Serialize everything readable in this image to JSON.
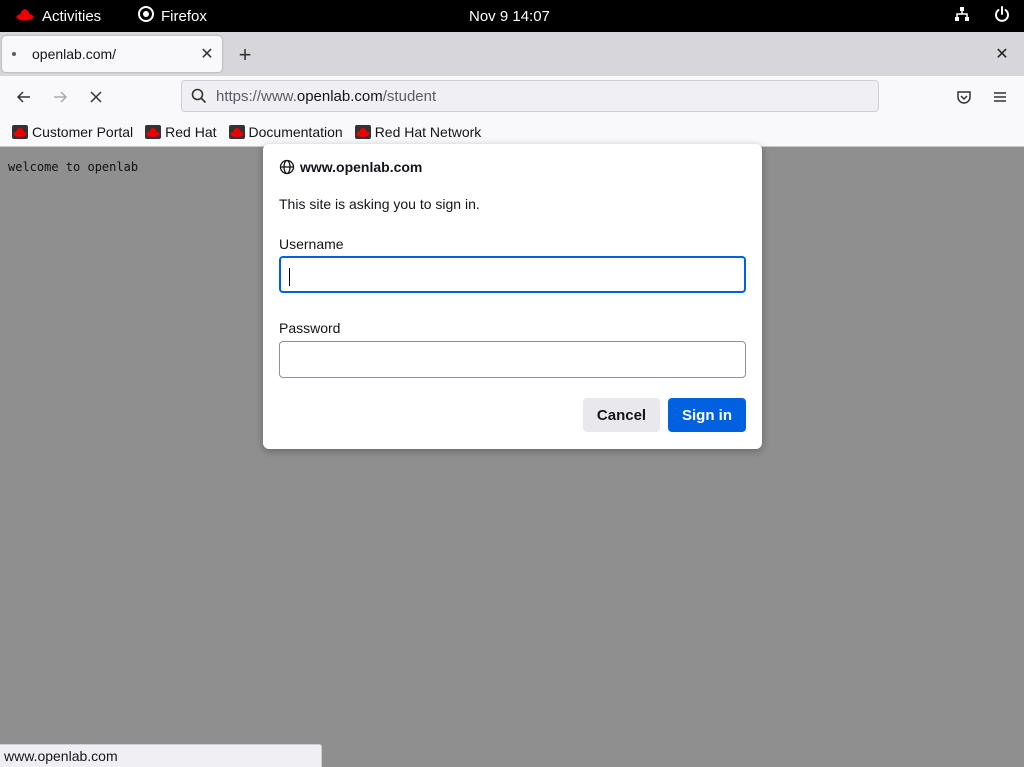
{
  "topbar": {
    "activities_label": "Activities",
    "app_label": "Firefox",
    "clock": "Nov 9  14:07",
    "icons": [
      "network-icon",
      "power-icon"
    ]
  },
  "browser": {
    "tab_title": "openlab.com/",
    "url_prefix": "https://www.",
    "url_host": "openlab.com",
    "url_path": "/student",
    "bookmarks": [
      "Customer Portal",
      "Red Hat",
      "Documentation",
      "Red Hat Network"
    ],
    "status_text": "www.openlab.com"
  },
  "page": {
    "body_text": "welcome to openlab"
  },
  "dialog": {
    "host": "www.openlab.com",
    "message": "This site is asking you to sign in.",
    "username_label": "Username",
    "username_value": "",
    "password_label": "Password",
    "password_value": "",
    "cancel_label": "Cancel",
    "signin_label": "Sign in",
    "accent_color": "#0061e0"
  }
}
